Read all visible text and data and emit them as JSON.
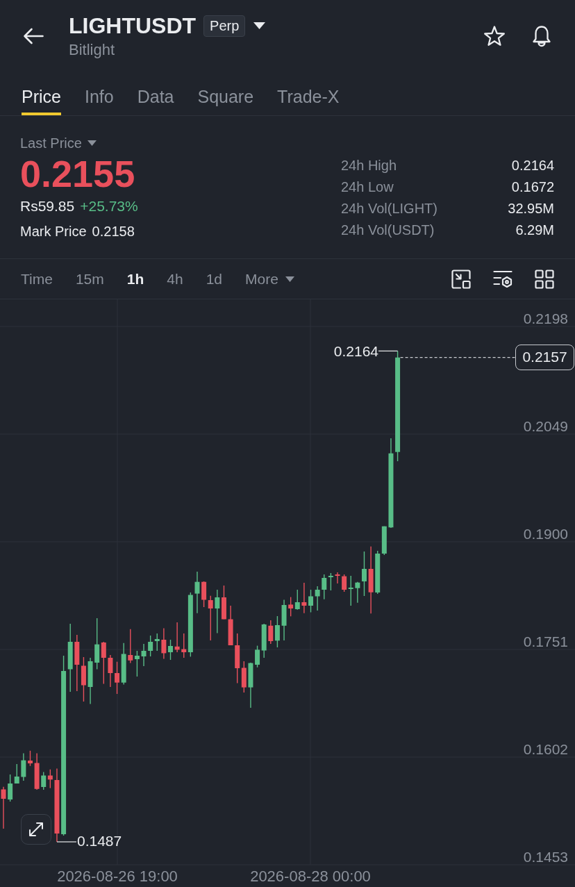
{
  "header": {
    "title": "LIGHTUSDT",
    "tag": "Perp",
    "subtitle": "Bitlight"
  },
  "tabs": [
    {
      "label": "Price",
      "selected": true
    },
    {
      "label": "Info",
      "selected": false
    },
    {
      "label": "Data",
      "selected": false
    },
    {
      "label": "Square",
      "selected": false
    },
    {
      "label": "Trade-X",
      "selected": false
    }
  ],
  "ticker": {
    "price_type": "Last Price",
    "price": "0.2155",
    "price_rising": false,
    "fiat_price": "Rs59.85",
    "change": "+25.73%",
    "change_rising": true,
    "mark_price_label": "Mark Price",
    "mark_price": "0.2158"
  },
  "stats": [
    {
      "label": "24h High",
      "value": "0.2164"
    },
    {
      "label": "24h Low",
      "value": "0.1672"
    },
    {
      "label": "24h Vol(LIGHT)",
      "value": "32.95M"
    },
    {
      "label": "24h Vol(USDT)",
      "value": "6.29M"
    }
  ],
  "intervals": [
    {
      "label": "Time",
      "kind": "option",
      "selected": false
    },
    {
      "label": "15m",
      "kind": "option",
      "selected": false
    },
    {
      "label": "1h",
      "kind": "option",
      "selected": true
    },
    {
      "label": "4h",
      "kind": "option",
      "selected": false
    },
    {
      "label": "1d",
      "kind": "option",
      "selected": false
    },
    {
      "label": "More",
      "kind": "menu",
      "selected": false
    }
  ],
  "chart": {
    "y_axis": [
      "0.2198",
      "0.2049",
      "0.1900",
      "0.1751",
      "0.1602",
      "0.1453"
    ],
    "x_axis": [
      "2026-08-26 19:00",
      "2026-08-28 00:00"
    ],
    "high_label": "0.2164",
    "low_label": "0.1487",
    "current_price": "0.2157"
  }
}
